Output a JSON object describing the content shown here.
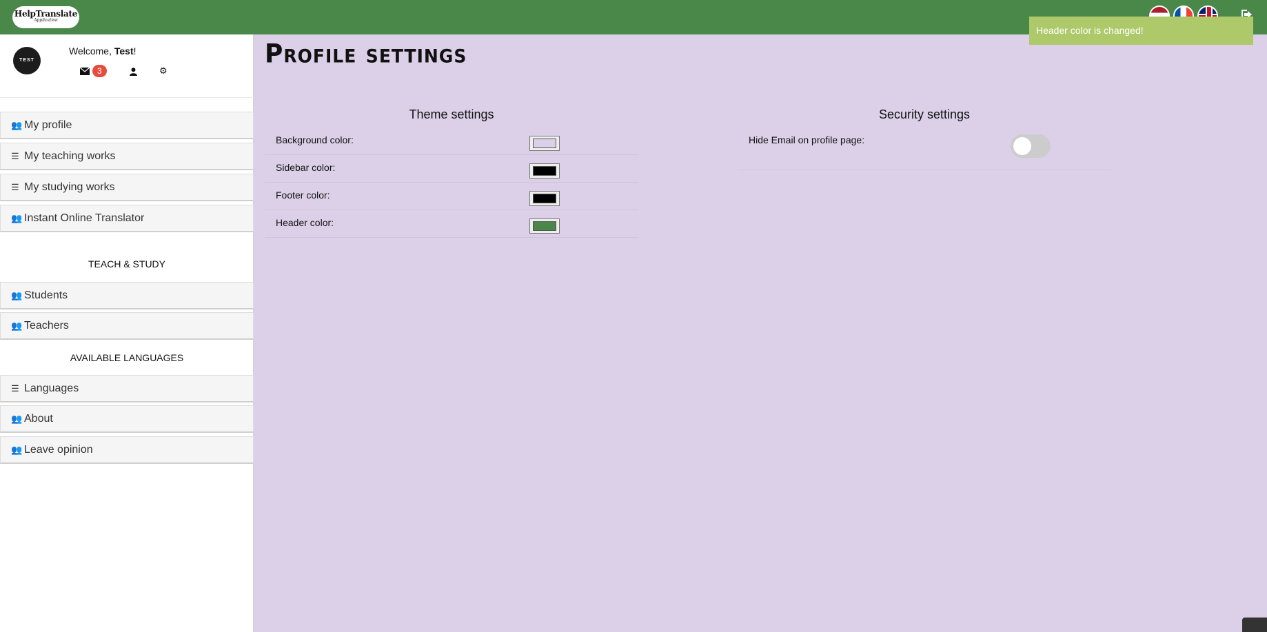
{
  "header": {
    "logo_title": "HelpTranslate",
    "logo_subtitle": "Application",
    "toast": "Header color is changed!",
    "colors": {
      "header": "#4a884a",
      "toast": "#adc96a"
    },
    "flags": [
      "nl-flag-icon",
      "fr-flag-icon",
      "uk-flag-icon"
    ],
    "logout_icon": "sign-out-icon"
  },
  "user": {
    "avatar_text": "TEST",
    "welcome_prefix": "Welcome, ",
    "name": "Test",
    "welcome_suffix": "!",
    "messages_count": "3",
    "icons": [
      "envelope-icon",
      "user-icon",
      "gear-icon"
    ]
  },
  "sidebar": {
    "items_top": [
      {
        "label": "My profile",
        "icon": "users-icon"
      },
      {
        "label": "My teaching works",
        "icon": "list-icon"
      },
      {
        "label": "My studying works",
        "icon": "list-icon"
      },
      {
        "label": "Instant Online Translator",
        "icon": "users-icon"
      }
    ],
    "section1": "TEACH & STUDY",
    "items_mid": [
      {
        "label": "Students",
        "icon": "users-icon"
      },
      {
        "label": "Teachers",
        "icon": "users-icon"
      }
    ],
    "section2": "AVAILABLE LANGUAGES",
    "items_bottom": [
      {
        "label": "Languages",
        "icon": "list-icon"
      },
      {
        "label": "About",
        "icon": "users-icon"
      },
      {
        "label": "Leave opinion",
        "icon": "users-icon"
      }
    ]
  },
  "main": {
    "title": "Profile settings",
    "background": "#dcd0e8",
    "theme": {
      "title": "Theme settings",
      "rows": [
        {
          "label": "Background color:",
          "color": "#dcd0e8"
        },
        {
          "label": "Sidebar color:",
          "color": "#000000"
        },
        {
          "label": "Footer color:",
          "color": "#000000"
        },
        {
          "label": "Header color:",
          "color": "#4a884a"
        }
      ]
    },
    "security": {
      "title": "Security settings",
      "rows": [
        {
          "label": "Hide Email on profile page:",
          "enabled": false
        }
      ]
    }
  }
}
